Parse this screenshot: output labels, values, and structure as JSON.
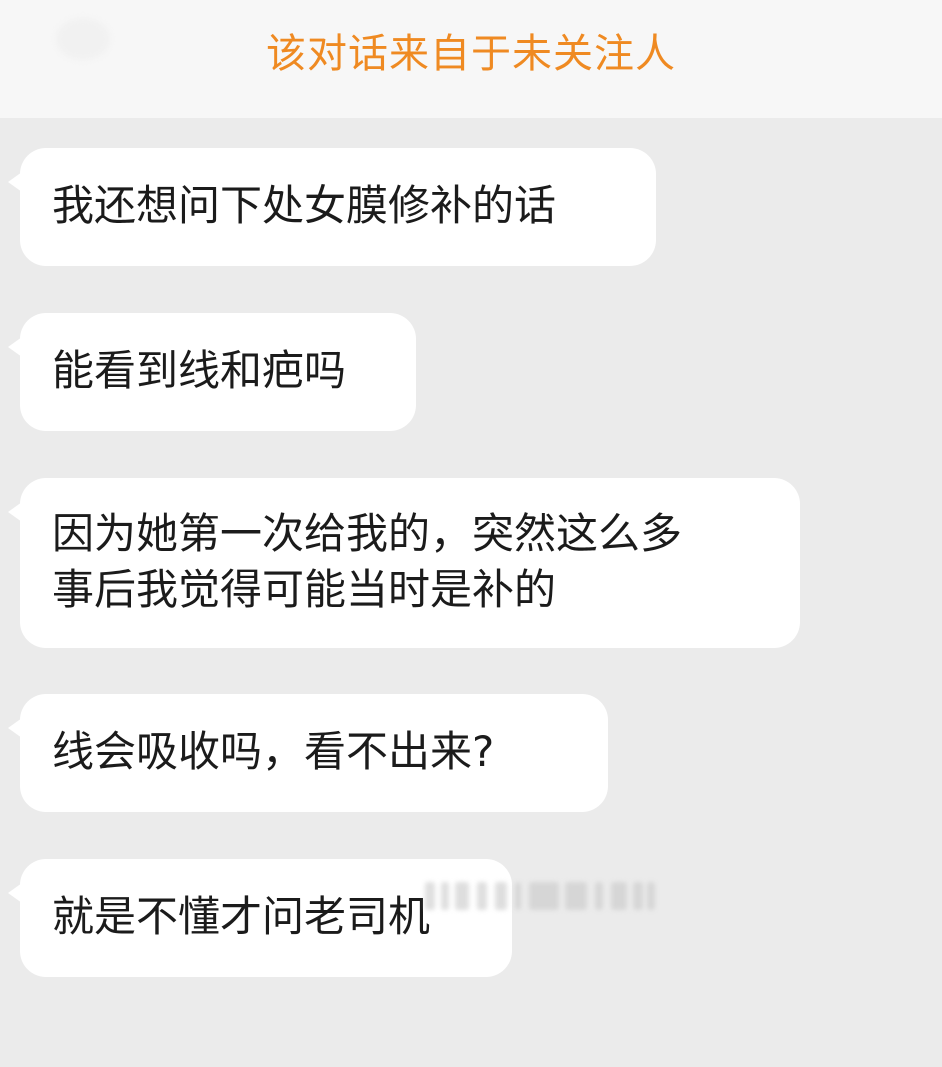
{
  "header": {
    "title": "该对话来自于未关注人"
  },
  "messages": [
    {
      "lines": [
        "我还想问下处女膜修补的话"
      ]
    },
    {
      "lines": [
        "能看到线和疤吗"
      ]
    },
    {
      "lines": [
        "因为她第一次给我的，突然这么多",
        "事后我觉得可能当时是补的"
      ]
    },
    {
      "lines": [
        "线会吸收吗，看不出来?"
      ]
    },
    {
      "lines": [
        "就是不懂才问老司机"
      ]
    }
  ],
  "colors": {
    "title": "#ef8a22",
    "background": "#ebebeb",
    "header_background": "#f7f7f7",
    "bubble": "#ffffff",
    "text": "#1b1b1b"
  }
}
